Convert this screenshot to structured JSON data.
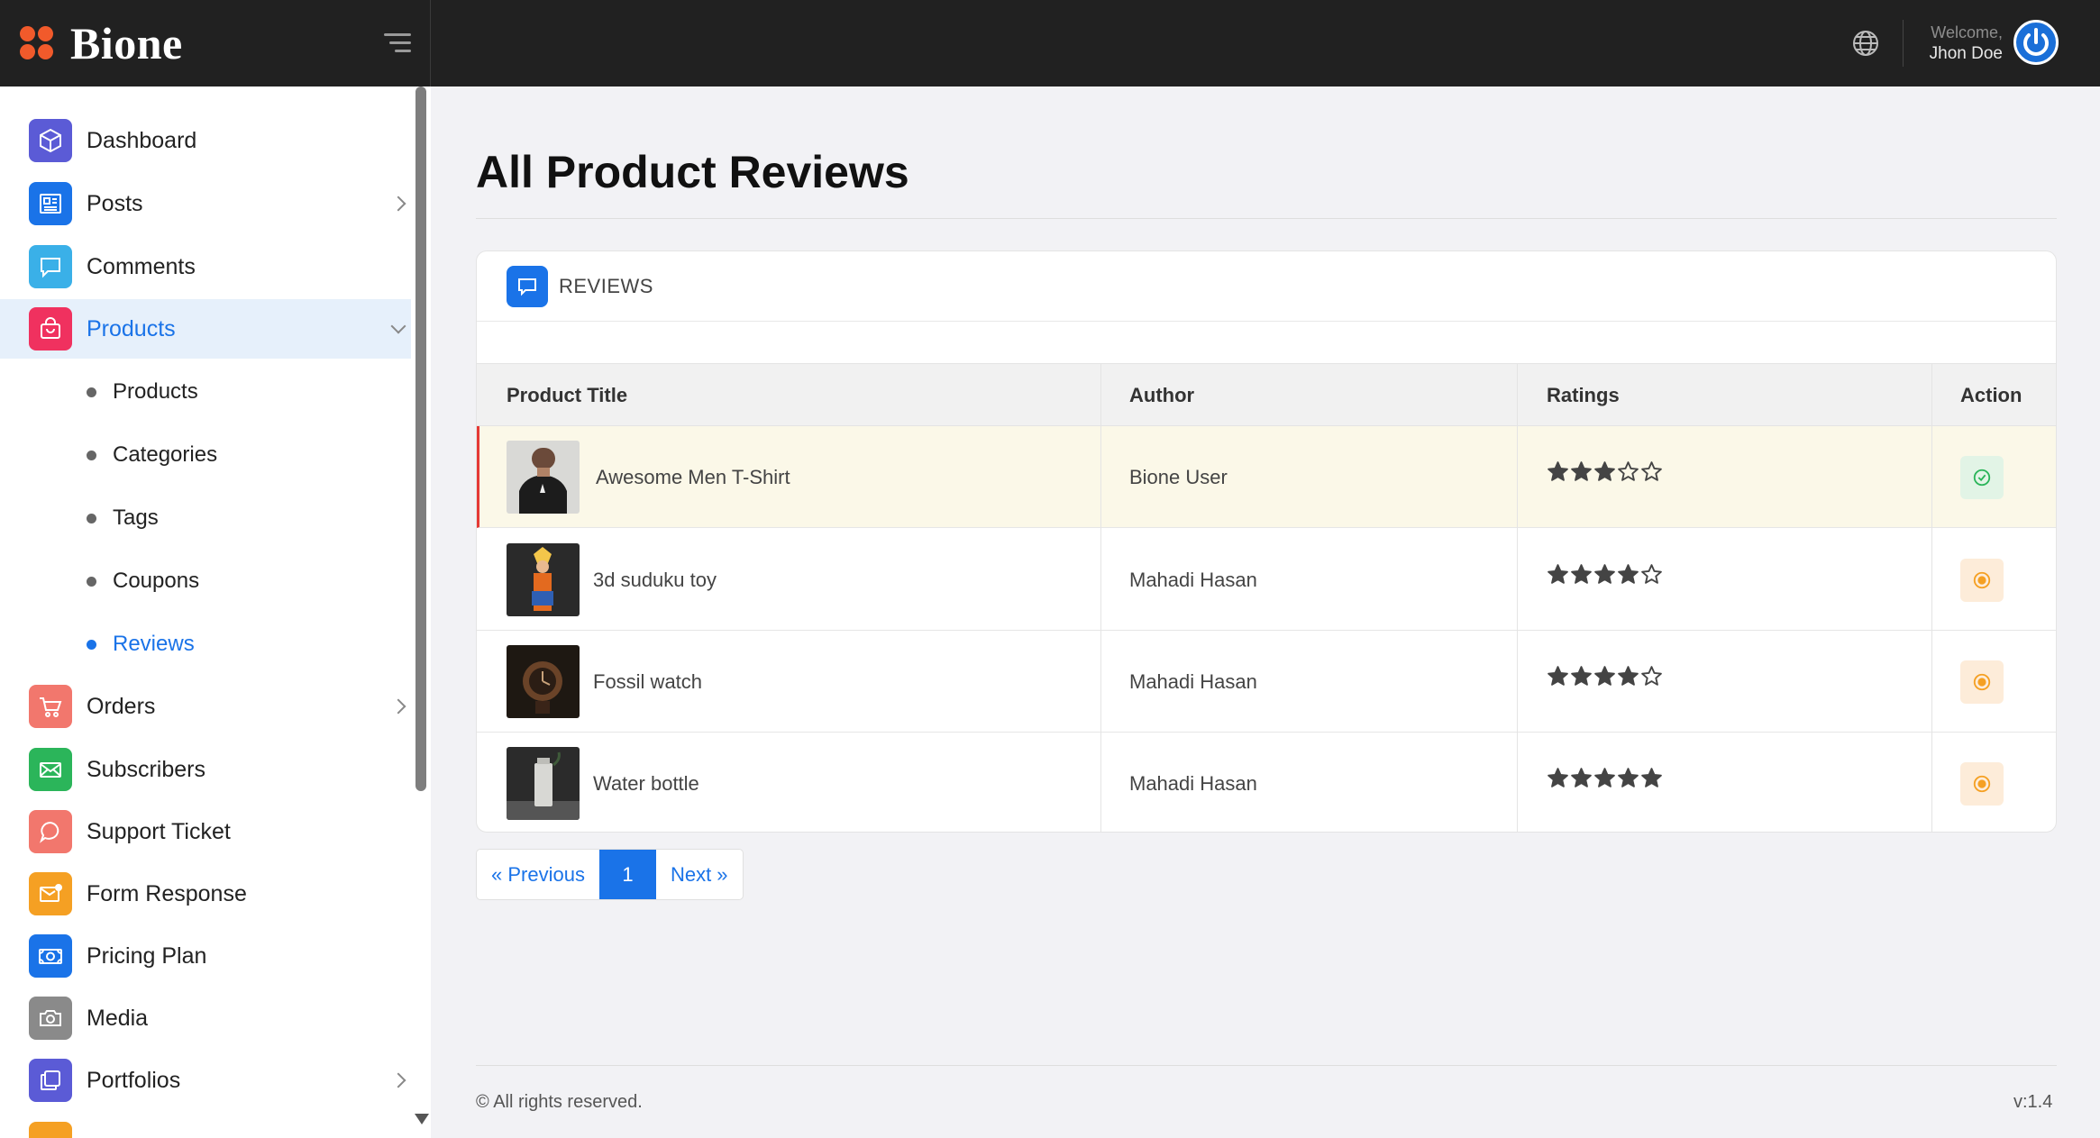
{
  "brand": {
    "name": "Bione",
    "accent": "#f15a2b"
  },
  "header": {
    "welcome": "Welcome,",
    "user_name": "Jhon Doe",
    "language_icon": "globe-icon",
    "avatar_icon": "power-icon"
  },
  "sidebar": {
    "items": [
      {
        "label": "Dashboard",
        "icon": "cube-icon",
        "color": "#5b5bd6"
      },
      {
        "label": "Posts",
        "icon": "newspaper-icon",
        "color": "#1a73e8",
        "has_children": true
      },
      {
        "label": "Comments",
        "icon": "comment-icon",
        "color": "#3ab0e8"
      },
      {
        "label": "Products",
        "icon": "shopping-bag-icon",
        "color": "#f0315f",
        "expanded": true,
        "active": true
      },
      {
        "label": "Orders",
        "icon": "cart-icon",
        "color": "#f2776d",
        "has_children": true
      },
      {
        "label": "Subscribers",
        "icon": "envelope-icon",
        "color": "#2bb55a"
      },
      {
        "label": "Support Ticket",
        "icon": "chat-bubble-icon",
        "color": "#f2776d"
      },
      {
        "label": "Form Response",
        "icon": "mail-notification-icon",
        "color": "#f5a023"
      },
      {
        "label": "Pricing Plan",
        "icon": "money-icon",
        "color": "#1a73e8"
      },
      {
        "label": "Media",
        "icon": "camera-icon",
        "color": "#8a8a8a"
      },
      {
        "label": "Portfolios",
        "icon": "layers-icon",
        "color": "#5b5bd6",
        "has_children": true
      }
    ],
    "product_subitems": [
      {
        "label": "Products"
      },
      {
        "label": "Categories"
      },
      {
        "label": "Tags"
      },
      {
        "label": "Coupons"
      },
      {
        "label": "Reviews",
        "active": true
      }
    ]
  },
  "page": {
    "title": "All Product Reviews"
  },
  "reviews_card": {
    "heading": "REVIEWS",
    "columns": {
      "title": "Product Title",
      "author": "Author",
      "ratings": "Ratings",
      "action": "Action"
    },
    "rows": [
      {
        "product": "Awesome Men T-Shirt",
        "author": "Bione User",
        "rating": 3,
        "status": "approved",
        "highlight": true
      },
      {
        "product": "3d suduku toy",
        "author": "Mahadi Hasan",
        "rating": 4,
        "status": "pending"
      },
      {
        "product": "Fossil watch",
        "author": "Mahadi Hasan",
        "rating": 4,
        "status": "pending"
      },
      {
        "product": "Water bottle",
        "author": "Mahadi Hasan",
        "rating": 5,
        "status": "pending"
      }
    ]
  },
  "pagination": {
    "previous": "« Previous",
    "current": "1",
    "next": "Next »"
  },
  "footer": {
    "copyright": "© All rights reserved.",
    "version": "v:1.4"
  }
}
